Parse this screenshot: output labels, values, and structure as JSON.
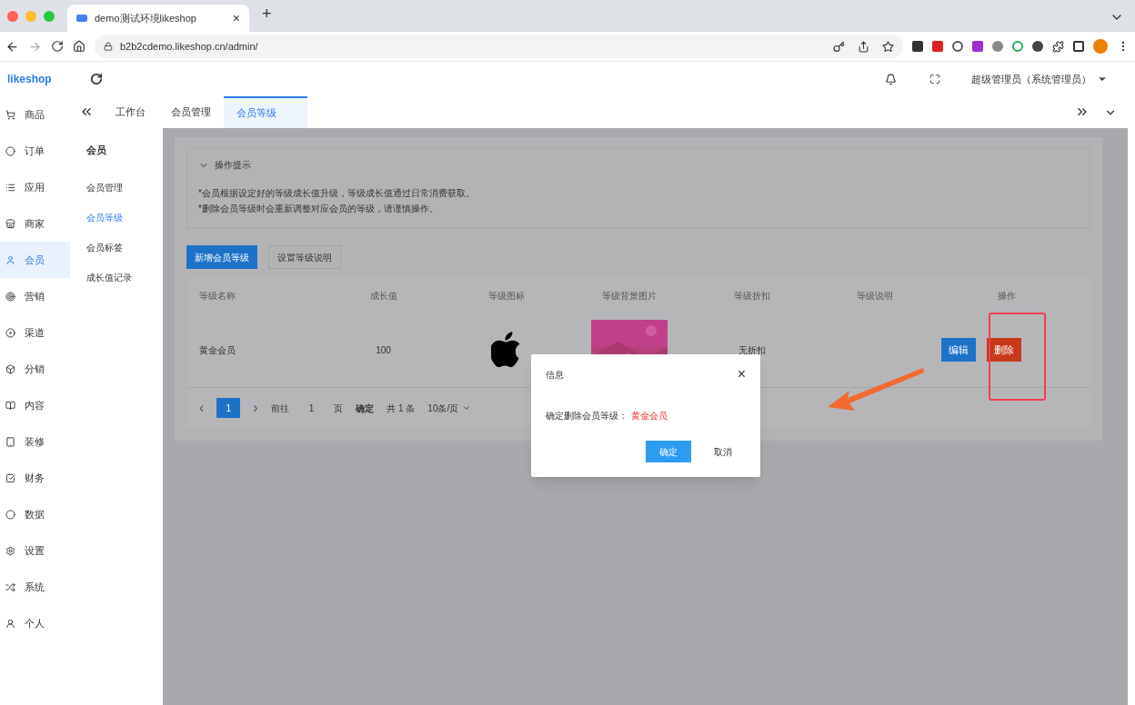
{
  "browser": {
    "tab_title": "demo测试环境likeshop",
    "tab_close": "×",
    "new_tab": "+",
    "url": "b2b2cdemo.likeshop.cn/admin/"
  },
  "app": {
    "logo": "likeshop",
    "user": "超级管理员（系统管理员）"
  },
  "sidebar": {
    "items": [
      {
        "label": "商品",
        "selected": false
      },
      {
        "label": "订单",
        "selected": false
      },
      {
        "label": "应用",
        "selected": false
      },
      {
        "label": "商家",
        "selected": false
      },
      {
        "label": "会员",
        "selected": true
      },
      {
        "label": "营销",
        "selected": false
      },
      {
        "label": "渠道",
        "selected": false
      },
      {
        "label": "分销",
        "selected": false
      },
      {
        "label": "内容",
        "selected": false
      },
      {
        "label": "装修",
        "selected": false
      },
      {
        "label": "财务",
        "selected": false
      },
      {
        "label": "数据",
        "selected": false
      },
      {
        "label": "设置",
        "selected": false
      },
      {
        "label": "系统",
        "selected": false
      },
      {
        "label": "个人",
        "selected": false
      }
    ]
  },
  "submenu": {
    "title": "会员",
    "items": [
      {
        "label": "会员管理",
        "selected": false
      },
      {
        "label": "会员等级",
        "selected": true
      },
      {
        "label": "会员标签",
        "selected": false
      },
      {
        "label": "成长值记录",
        "selected": false
      }
    ]
  },
  "tabs": [
    {
      "label": "工作台",
      "selected": false
    },
    {
      "label": "会员管理",
      "selected": false
    },
    {
      "label": "会员等级",
      "selected": true
    }
  ],
  "tips": {
    "title": "操作提示",
    "expanded": true,
    "lines": [
      "*会员根据设定好的等级成长值升级，等级成长值通过日常消费获取。",
      "*删除会员等级时会重新调整对应会员的等级，请谨慎操作。"
    ]
  },
  "toolbar": {
    "primary": "新增会员等级",
    "secondary": "设置等级说明"
  },
  "table": {
    "columns": [
      "等级名称",
      "成长值",
      "等级图标",
      "等级背景图片",
      "等级折扣",
      "等级说明",
      "操作"
    ],
    "rows": [
      {
        "name": "黄金会员",
        "growth": "100",
        "discount": "无折扣",
        "actions": [
          "编辑",
          "删除"
        ]
      }
    ]
  },
  "pagination": {
    "prev": "‹",
    "pages": [
      {
        "label": "1",
        "selected": true
      }
    ],
    "next": "›",
    "goto": "前往",
    "page_value": "1",
    "page_unit": "页",
    "confirm": "确定",
    "total": "共 1 条",
    "page_size": "10条/页"
  },
  "dialog": {
    "title": "信息",
    "close": "×",
    "message": "确定删除会员等级：",
    "highlight": "黄金会员",
    "ok": "确定",
    "cancel": "取消"
  }
}
